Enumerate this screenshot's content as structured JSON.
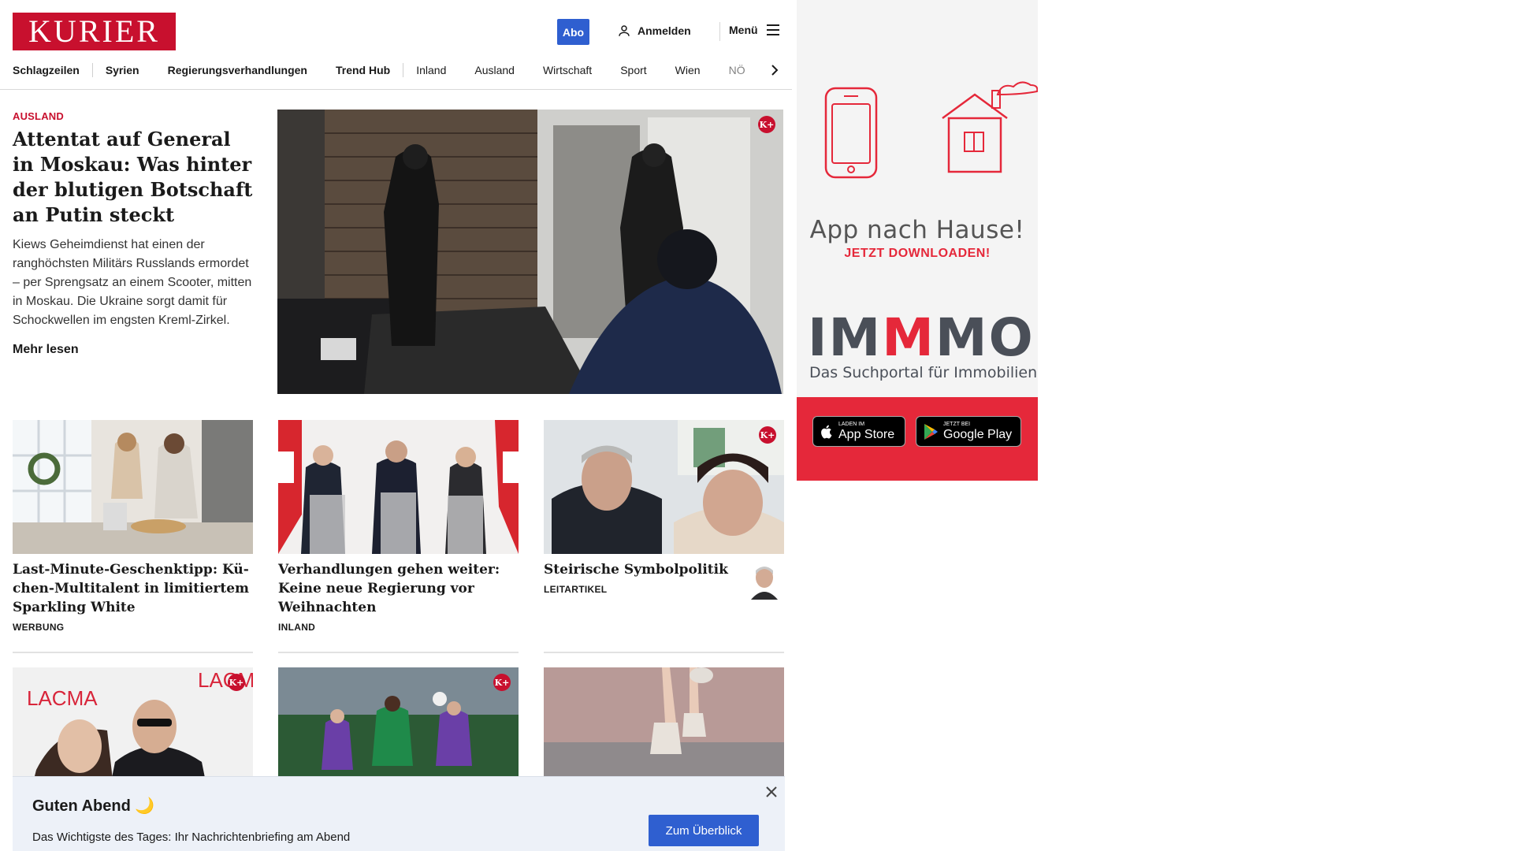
{
  "header": {
    "logo_text": "KURIER",
    "abo_label": "Abo",
    "login_label": "Anmelden",
    "menu_label": "Menü"
  },
  "nav": {
    "items": [
      "Schlagzeilen",
      "Syrien",
      "Regierungsverhandlungen",
      "Trend Hub",
      "Inland",
      "Ausland",
      "Wirtschaft",
      "Sport",
      "Wien",
      "NÖ"
    ]
  },
  "hero": {
    "kicker": "AUSLAND",
    "title": "Attentat auf General in Moskau: Was hinter der blutigen Botschaft an Pu­tin steckt",
    "teaser": "Kiews Geheimdienst hat einen der ranghöchsten Militärs Russlands ermordet – per Sprengsatz an einem Scooter, mitten in Moskau. Die Ukraine sorgt damit für Schockwellen im engsten Kreml-Zirkel.",
    "more_label": "Mehr lesen",
    "badge": "K+"
  },
  "cards": [
    {
      "title": "Last-Minute-Geschenktipp: Kü­chen-Multitalent in limitiertem Sparkling White",
      "category": "WERBUNG"
    },
    {
      "title": "Verhandlungen gehen weiter: Keine neue Regierung vor Weihnachten",
      "category": "INLAND"
    },
    {
      "title": "Steirische Symbolpolitik",
      "category": "LEITARTIKEL",
      "badge": "K+"
    }
  ],
  "row2": [
    {
      "badge": "K+",
      "image_text": "LACMA"
    },
    {
      "badge": "K+"
    },
    {}
  ],
  "ad": {
    "headline": "App nach Hause!",
    "cta": "JETZT DOWNLOADEN!",
    "brand_a": "IM",
    "brand_m": "M",
    "brand_b": "MO",
    "brand_sub": "Das Suchportal für Immobilien",
    "appstore_small": "Laden im",
    "appstore_big": "App Store",
    "googleplay_small": "JETZT BEI",
    "googleplay_big": "Google Play"
  },
  "briefing": {
    "greeting": "Guten Abend 🌙",
    "description": "Das Wichtigste des Tages: Ihr Nachrichtenbriefing am Abend",
    "button_label": "Zum Überblick"
  },
  "colors": {
    "brand_red": "#c8102e",
    "button_blue": "#2f5fd0",
    "ad_red": "#e5283a"
  }
}
